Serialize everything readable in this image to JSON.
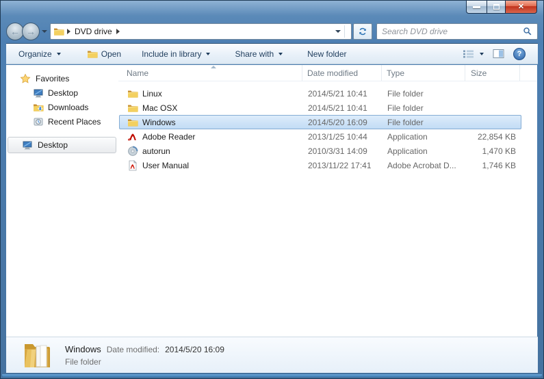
{
  "window": {
    "controls": {
      "close_glyph": "✕",
      "back_glyph": "←",
      "forward_glyph": "→"
    }
  },
  "navbar": {
    "breadcrumb": {
      "location": "DVD drive"
    },
    "search_placeholder": "Search DVD drive"
  },
  "toolbar": {
    "organize": "Organize",
    "open": "Open",
    "include": "Include in library",
    "share": "Share with",
    "new_folder": "New folder",
    "help_glyph": "?"
  },
  "sidebar": {
    "favorites_label": "Favorites",
    "favorites_items": [
      {
        "label": "Desktop"
      },
      {
        "label": "Downloads"
      },
      {
        "label": "Recent Places"
      }
    ],
    "tree_desktop_label": "Desktop"
  },
  "filelist": {
    "columns": {
      "name": "Name",
      "date": "Date modified",
      "type": "Type",
      "size": "Size"
    },
    "sort": {
      "column": "Name",
      "direction": "ascending"
    },
    "rows": [
      {
        "name": "Linux",
        "icon": "folder",
        "date": "2014/5/21 10:41",
        "type": "File folder",
        "size": ""
      },
      {
        "name": "Mac OSX",
        "icon": "folder",
        "date": "2014/5/21 10:41",
        "type": "File folder",
        "size": ""
      },
      {
        "name": "Windows",
        "icon": "folder",
        "date": "2014/5/20 16:09",
        "type": "File folder",
        "size": "",
        "selected": true
      },
      {
        "name": "Adobe Reader",
        "icon": "adobe",
        "date": "2013/1/25 10:44",
        "type": "Application",
        "size": "22,854 KB"
      },
      {
        "name": "autorun",
        "icon": "autorun",
        "date": "2010/3/31 14:09",
        "type": "Application",
        "size": "1,470 KB"
      },
      {
        "name": "User Manual",
        "icon": "pdf",
        "date": "2013/11/22 17:41",
        "type": "Adobe Acrobat D...",
        "size": "1,746 KB"
      }
    ]
  },
  "details": {
    "name": "Windows",
    "date_label": "Date modified:",
    "date_value": "2014/5/20 16:09",
    "type": "File folder"
  },
  "colors": {
    "glass_blue": "#4d7fb2",
    "selection_fill": "#c2dcf5",
    "selection_border": "#84acd4",
    "toolbar_text": "#1e3c5c",
    "close_red": "#c0321c",
    "folder_yellow": "#f3d060"
  }
}
